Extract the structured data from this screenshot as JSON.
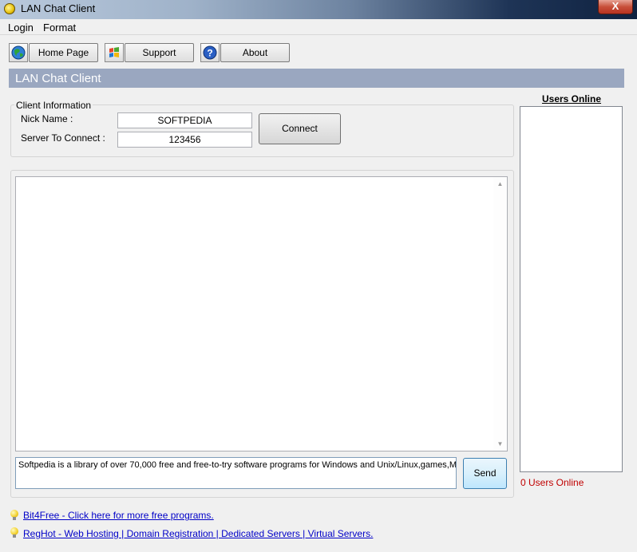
{
  "window": {
    "title": "LAN Chat Client",
    "close_label": "X"
  },
  "menu": [
    "Login",
    "Format"
  ],
  "toolbar": {
    "home_label": "Home Page",
    "support_label": "Support",
    "about_label": "About",
    "icons": [
      "globe-icon",
      "windows-logo-icon",
      "help-icon"
    ]
  },
  "header": {
    "title": "LAN Chat Client"
  },
  "client_info": {
    "group_title": "Client Information",
    "nick_label": "Nick Name   :",
    "nick_value": "SOFTPEDIA",
    "server_label": "Server To Connect :",
    "server_value": "123456",
    "connect_label": "Connect"
  },
  "chat": {
    "message_input": "Softpedia is a library of over 70,000 free and free-to-try software programs for Windows and Unix/Linux,games,M",
    "send_label": "Send"
  },
  "users": {
    "title": "Users Online",
    "count_text": "0 Users Online"
  },
  "links": {
    "bit4free": "Bit4Free - Click here for more free programs.",
    "reghot": "RegHot - Web Hosting | Domain Registration | Dedicated Servers | Virtual Servers."
  },
  "colors": {
    "header_band": "#9aa7c0",
    "users_count": "#c00000",
    "link": "#0000c8"
  }
}
